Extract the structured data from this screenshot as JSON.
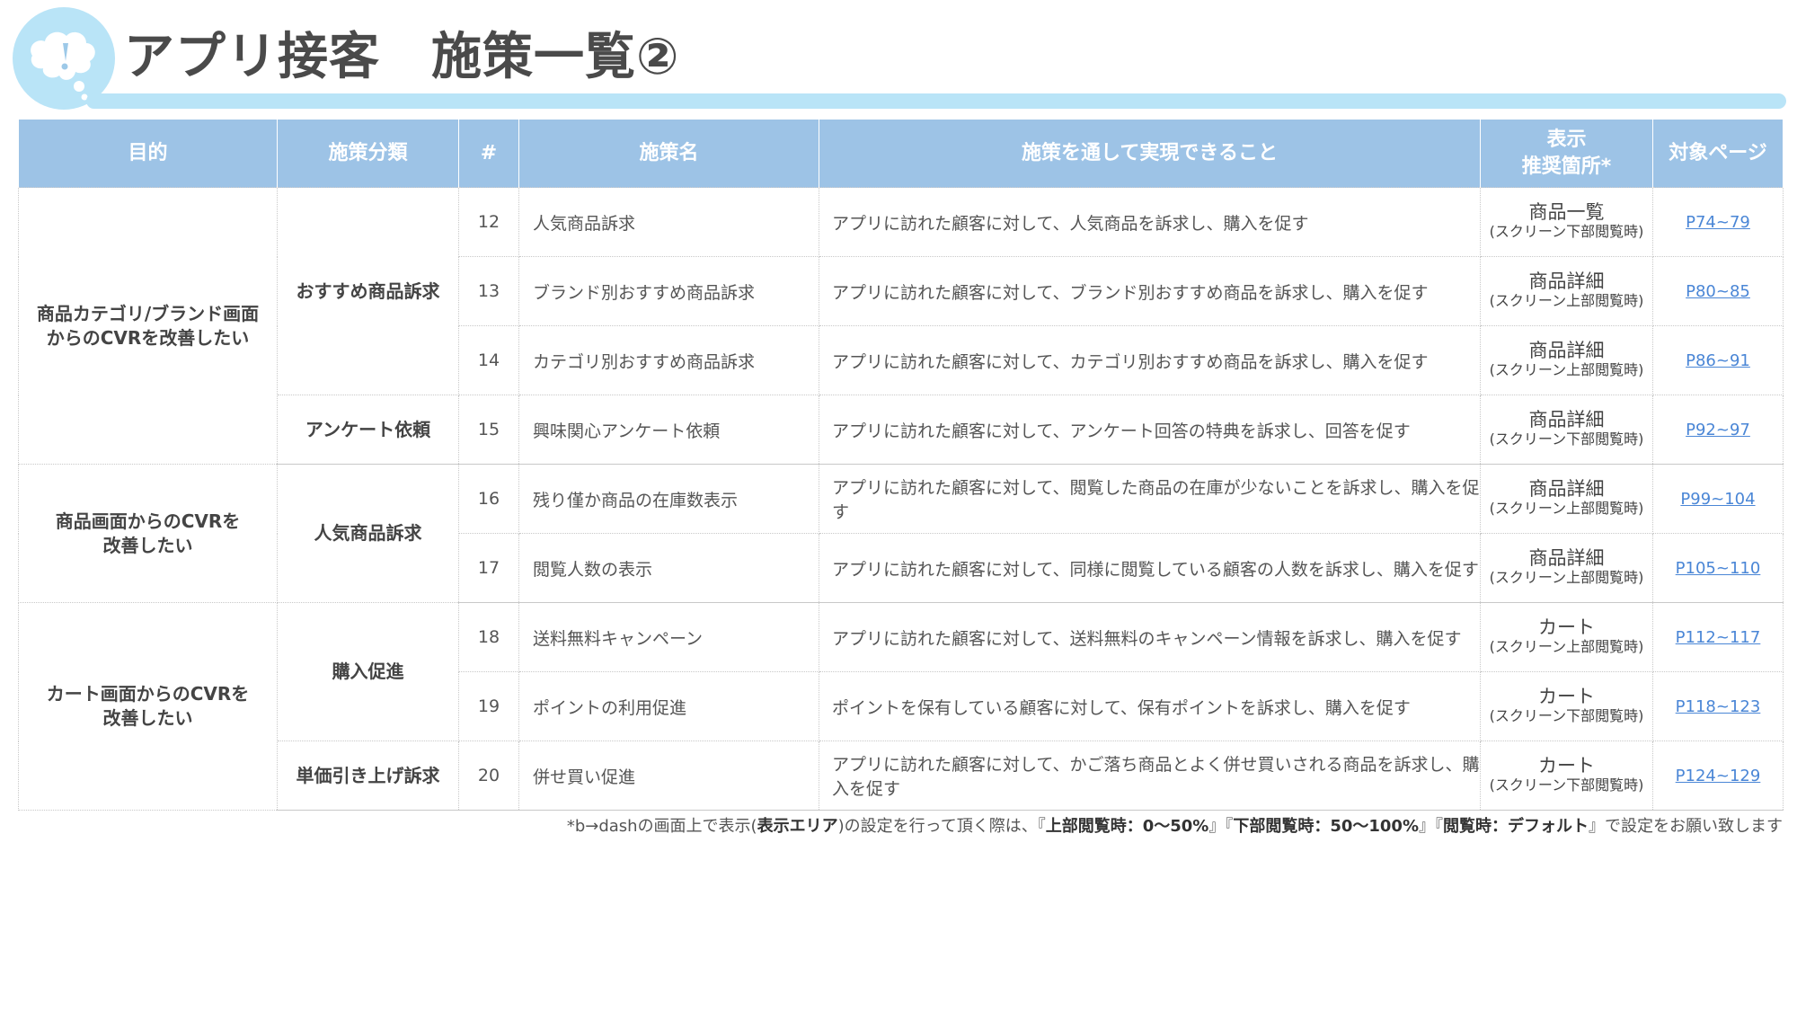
{
  "header": {
    "title": "アプリ接客　施策一覧②",
    "icon": "speech-bubble-exclamation-icon",
    "accent_color": "#b9e4f7"
  },
  "table": {
    "header_color": "#9dc3e6",
    "link_color": "#4a86d6",
    "columns": {
      "purpose": "目的",
      "category": "施策分類",
      "number": "#",
      "name": "施策名",
      "achieve": "施策を通して実現できること",
      "area_line1": "表示",
      "area_line2": "推奨箇所*",
      "page": "対象ページ"
    },
    "purposes": [
      {
        "line1": "商品カテゴリ/ブランド画面",
        "line2": "からのCVRを改善したい"
      },
      {
        "line1": "商品画面からのCVRを",
        "line2": "改善したい"
      },
      {
        "line1": "カート画面からのCVRを",
        "line2": "改善したい"
      }
    ],
    "categories": [
      "おすすめ商品訴求",
      "アンケート依頼",
      "人気商品訴求",
      "購入促進",
      "単価引き上げ訴求"
    ],
    "rows": [
      {
        "num": "12",
        "name": "人気商品訴求",
        "achieve": "アプリに訪れた顧客に対して、人気商品を訴求し、購入を促す",
        "area": "商品一覧",
        "area_sub": "(スクリーン下部閲覧時)",
        "page": "P74~79"
      },
      {
        "num": "13",
        "name": "ブランド別おすすめ商品訴求",
        "achieve": "アプリに訪れた顧客に対して、ブランド別おすすめ商品を訴求し、購入を促す",
        "area": "商品詳細",
        "area_sub": "(スクリーン上部閲覧時)",
        "page": "P80~85"
      },
      {
        "num": "14",
        "name": "カテゴリ別おすすめ商品訴求",
        "achieve": "アプリに訪れた顧客に対して、カテゴリ別おすすめ商品を訴求し、購入を促す",
        "area": "商品詳細",
        "area_sub": "(スクリーン上部閲覧時)",
        "page": "P86~91"
      },
      {
        "num": "15",
        "name": "興味関心アンケート依頼",
        "achieve": "アプリに訪れた顧客に対して、アンケート回答の特典を訴求し、回答を促す",
        "area": "商品詳細",
        "area_sub": "(スクリーン下部閲覧時)",
        "page": "P92~97"
      },
      {
        "num": "16",
        "name": "残り僅か商品の在庫数表示",
        "achieve": "アプリに訪れた顧客に対して、閲覧した商品の在庫が少ないことを訴求し、購入を促す",
        "area": "商品詳細",
        "area_sub": "(スクリーン上部閲覧時)",
        "page": "P99~104"
      },
      {
        "num": "17",
        "name": "閲覧人数の表示",
        "achieve": "アプリに訪れた顧客に対して、同様に閲覧している顧客の人数を訴求し、購入を促す",
        "area": "商品詳細",
        "area_sub": "(スクリーン上部閲覧時)",
        "page": "P105~110"
      },
      {
        "num": "18",
        "name": "送料無料キャンペーン",
        "achieve": "アプリに訪れた顧客に対して、送料無料のキャンペーン情報を訴求し、購入を促す",
        "area": "カート",
        "area_sub": "(スクリーン上部閲覧時)",
        "page": "P112~117"
      },
      {
        "num": "19",
        "name": "ポイントの利用促進",
        "achieve": "ポイントを保有している顧客に対して、保有ポイントを訴求し、購入を促す",
        "area": "カート",
        "area_sub": "(スクリーン下部閲覧時)",
        "page": "P118~123"
      },
      {
        "num": "20",
        "name": "併せ買い促進",
        "achieve": "アプリに訪れた顧客に対して、かご落ち商品とよく併せ買いされる商品を訴求し、購入を促す",
        "area": "カート",
        "area_sub": "(スクリーン下部閲覧時)",
        "page": "P124~129"
      }
    ]
  },
  "footnote": {
    "part1": "*b→dashの画面上で表示(",
    "bold1": "表示エリア",
    "part2": ")の設定を行って頂く際は、『",
    "bold2": "上部閲覧時：0～50%",
    "part3": "』『",
    "bold3": "下部閲覧時：50～100%",
    "part4": "』『",
    "bold4": "閲覧時：デフォルト",
    "part5": "』で設定をお願い致します"
  }
}
